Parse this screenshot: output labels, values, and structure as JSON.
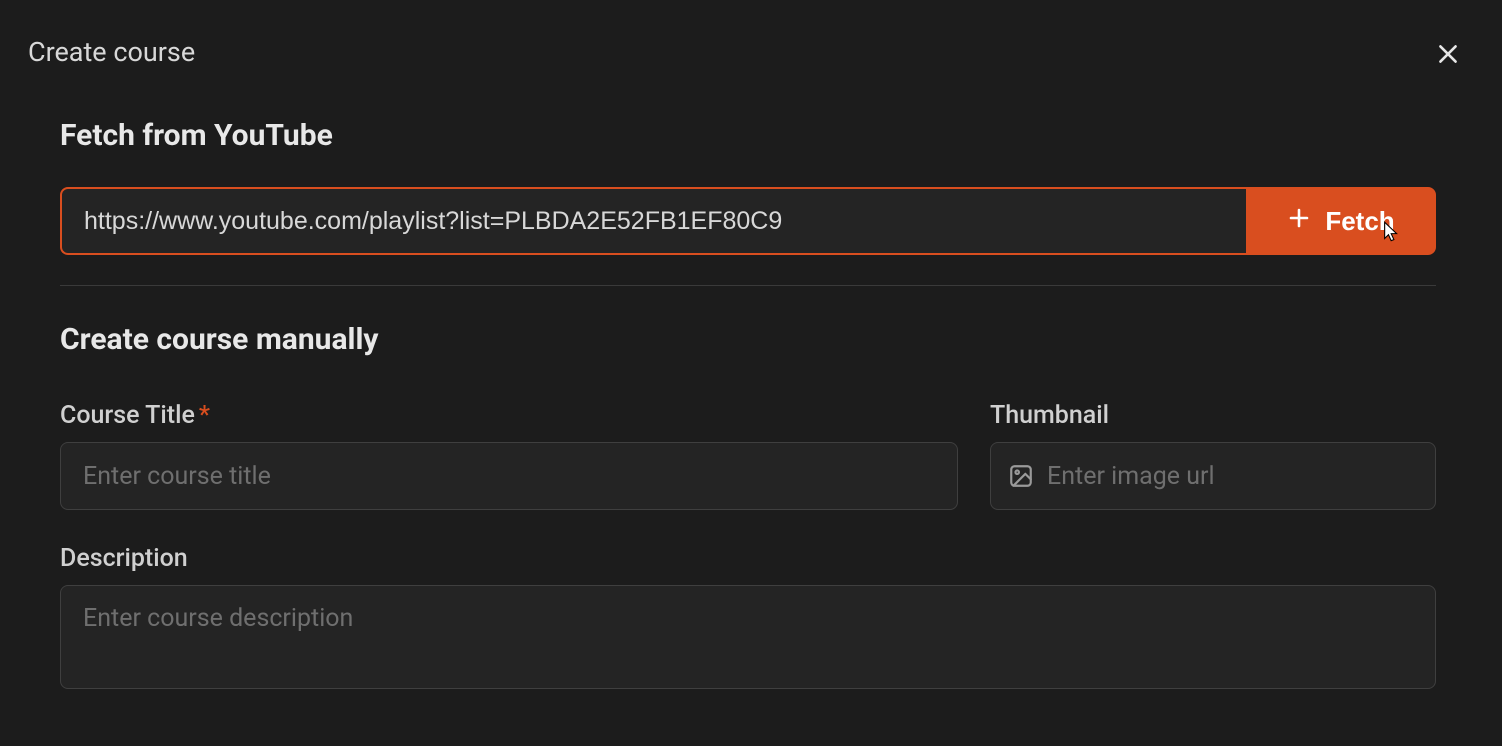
{
  "modal": {
    "title": "Create course"
  },
  "youtube": {
    "heading": "Fetch from YouTube",
    "url_value": "https://www.youtube.com/playlist?list=PLBDA2E52FB1EF80C9",
    "fetch_label": "Fetch"
  },
  "manual": {
    "heading": "Create course manually",
    "course_title_label": "Course Title",
    "course_title_placeholder": "Enter course title",
    "thumbnail_label": "Thumbnail",
    "thumbnail_placeholder": "Enter image url",
    "description_label": "Description",
    "description_placeholder": "Enter course description"
  },
  "colors": {
    "accent": "#d94e1f"
  }
}
